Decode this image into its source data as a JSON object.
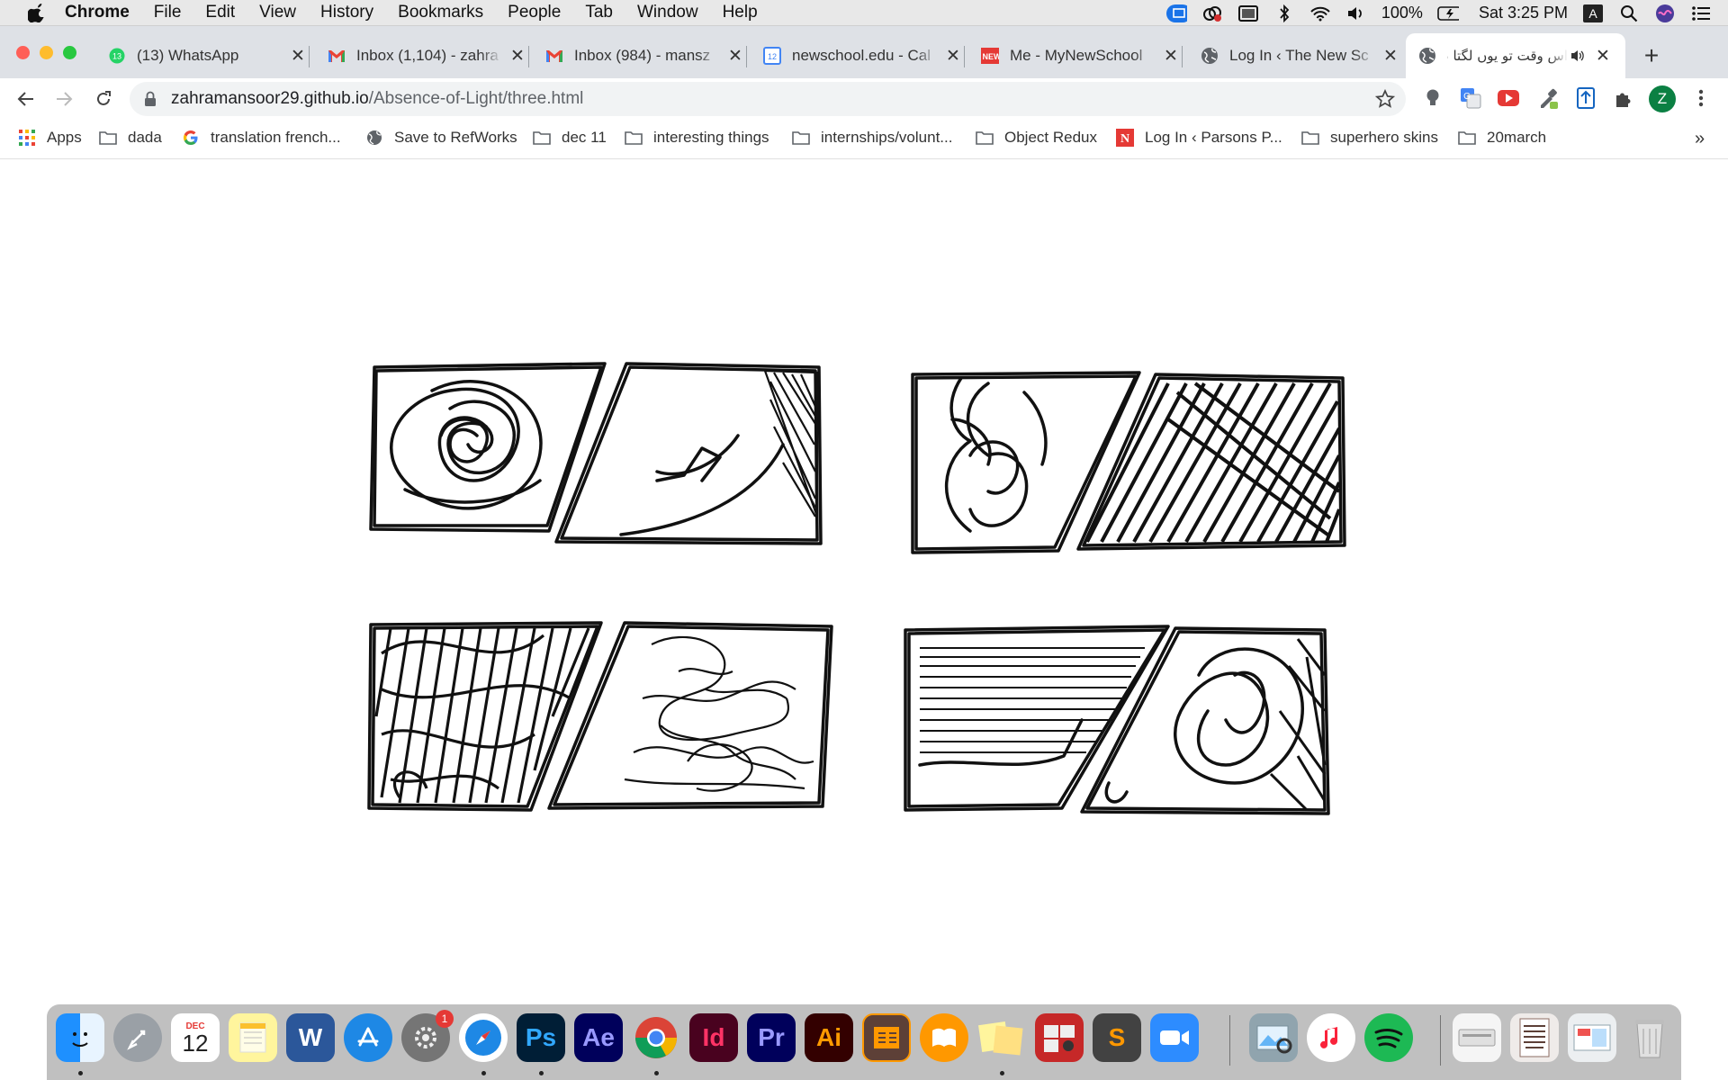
{
  "menubar": {
    "app_name": "Chrome",
    "items": [
      "File",
      "Edit",
      "View",
      "History",
      "Bookmarks",
      "People",
      "Tab",
      "Window",
      "Help"
    ],
    "battery": "100%",
    "clock": "Sat 3:25 PM",
    "input_source": "A"
  },
  "tabs": [
    {
      "title": "(13) WhatsApp",
      "favicon": "whatsapp-icon",
      "badge": "13"
    },
    {
      "title": "Inbox (1,104) - zahra",
      "favicon": "gmail-icon"
    },
    {
      "title": "Inbox (984) - mansz",
      "favicon": "gmail-icon"
    },
    {
      "title": "newschool.edu - Cal",
      "favicon": "calendar-icon",
      "badge": "12"
    },
    {
      "title": "Me - MyNewSchool",
      "favicon": "new-icon",
      "badge": "NEW"
    },
    {
      "title": "Log In ‹ The New Sc",
      "favicon": "globe-icon"
    },
    {
      "title": "اس وقت تو یوں لگتا ہے",
      "favicon": "globe-icon",
      "active": true
    }
  ],
  "address_bar": {
    "host": "zahramansoor29.github.io",
    "path": "/Absence-of-Light/three.html"
  },
  "profile_initial": "Z",
  "bookmarks": [
    {
      "label": "Apps",
      "icon": "apps-grid-icon"
    },
    {
      "label": "dada",
      "icon": "folder-icon"
    },
    {
      "label": "translation french...",
      "icon": "google-icon"
    },
    {
      "label": "Save to RefWorks",
      "icon": "globe-icon"
    },
    {
      "label": "dec 11",
      "icon": "folder-icon"
    },
    {
      "label": "interesting things",
      "icon": "folder-icon"
    },
    {
      "label": "internships/volunt...",
      "icon": "folder-icon"
    },
    {
      "label": "Object Redux",
      "icon": "folder-icon"
    },
    {
      "label": "Log In ‹ Parsons P...",
      "icon": "parsons-icon"
    },
    {
      "label": "superhero skins",
      "icon": "folder-icon"
    },
    {
      "label": "20march",
      "icon": "folder-icon"
    }
  ],
  "calendar_icon": {
    "month": "DEC",
    "day": "12"
  },
  "dock": {
    "apps": [
      "Finder",
      "Launchpad",
      "Calendar",
      "Notes",
      "Word",
      "App Store",
      "System Preferences",
      "Safari",
      "Ps",
      "Ae",
      "Chrome",
      "Id",
      "Pr",
      "Ai",
      "Sketchbook",
      "Books",
      "Stickies",
      "Photo Booth",
      "Sublime Text",
      "Zoom",
      "Preview",
      "Music",
      "Spotify"
    ],
    "system_prefs_badge": "1"
  },
  "colors": {
    "tabstrip": "#dee1e6",
    "menubar": "#e8e8e8",
    "sketch_ink": "#111111",
    "close_red": "#ff5f57",
    "minimize_yellow": "#febc2e",
    "zoom_green": "#28c840"
  }
}
